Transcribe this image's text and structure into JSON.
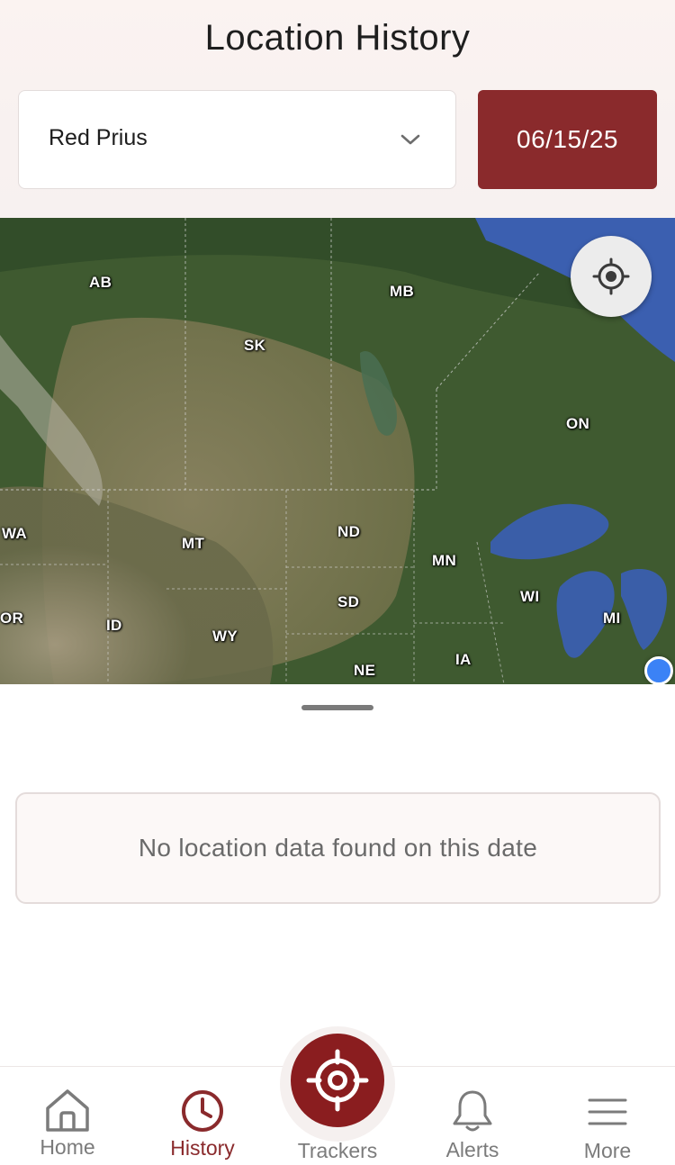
{
  "header": {
    "title": "Location History",
    "vehicle_select": {
      "selected": "Red Prius"
    },
    "date_button": {
      "label": "06/15/25"
    }
  },
  "map": {
    "region_labels": [
      "AB",
      "MB",
      "SK",
      "ON",
      "WA",
      "MT",
      "ND",
      "MN",
      "WI",
      "SD",
      "MI",
      "OR",
      "ID",
      "WY",
      "IA",
      "NE"
    ],
    "locate_icon": "crosshair-icon"
  },
  "sheet": {
    "empty_message": "No location data found on this date"
  },
  "tabbar": {
    "tabs": [
      {
        "label": "Home",
        "icon": "home-icon",
        "active": false
      },
      {
        "label": "History",
        "icon": "clock-icon",
        "active": true
      },
      {
        "label": "Trackers",
        "icon": "target-icon",
        "active": false
      },
      {
        "label": "Alerts",
        "icon": "bell-icon",
        "active": false
      },
      {
        "label": "More",
        "icon": "menu-icon",
        "active": false
      }
    ]
  },
  "colors": {
    "brand": "#8a2a2c",
    "brand_dark": "#8a1d1f",
    "inactive_text": "#7b7b7b"
  }
}
